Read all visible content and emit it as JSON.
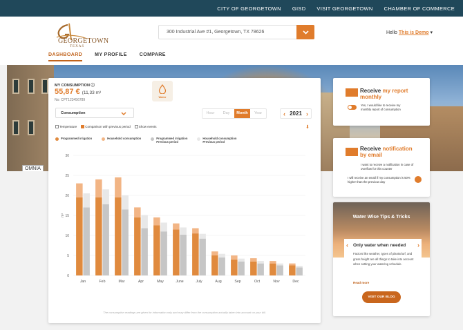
{
  "topbar": {
    "links": [
      "CITY OF GEORGETOWN",
      "GISD",
      "VISIT GEORGETOWN",
      "CHAMBER OF COMMERCE"
    ]
  },
  "brand": {
    "name": "GEORGETOWN",
    "sub": "TEXAS"
  },
  "address": {
    "value": "300 Industrial Ave #1, Georgetown, TX 78626"
  },
  "user": {
    "greeting": "Hello",
    "name": "This is Demo"
  },
  "nav": {
    "items": [
      "DASHBOARD",
      "MY PROFILE",
      "COMPARE"
    ],
    "active": "DASHBOARD"
  },
  "hero": {
    "sign": "OMNIA"
  },
  "consumption": {
    "title": "MY CONSUMPTION",
    "value": "55,87 €",
    "volume": "(11,33 m³",
    "number": "No: CPT123456789",
    "badge": "Water"
  },
  "controls": {
    "select": "Consumption",
    "periods": [
      "Hour",
      "Day",
      "Month",
      "Year"
    ],
    "active_period": "Month",
    "year": "2021",
    "checks": [
      {
        "label": "Temperature",
        "checked": false
      },
      {
        "label": "Comparison with previous period",
        "checked": true
      },
      {
        "label": "Show events",
        "checked": false
      }
    ]
  },
  "legend": [
    {
      "line1": "Programmed irrigation",
      "line2": "",
      "color": "#e08a3e"
    },
    {
      "line1": "Household consumption",
      "line2": "",
      "color": "#f2b585"
    },
    {
      "line1": "Programmed irrigation",
      "line2": "Previous period",
      "color": "#c6c6c6"
    },
    {
      "line1": "Household consumption",
      "line2": "Previous period",
      "color": "#e8e8e8"
    }
  ],
  "chart_data": {
    "type": "bar",
    "ylabel": "m³",
    "ylim": [
      0,
      30
    ],
    "yticks": [
      0,
      5,
      10,
      15,
      20,
      25,
      30
    ],
    "categories": [
      "Jan",
      "Feb",
      "Mar",
      "Apr",
      "May",
      "June",
      "July",
      "Aug",
      "Sep",
      "Oct",
      "Nov",
      "Dec"
    ],
    "series": [
      {
        "name": "Programmed irrigation",
        "values": [
          19.5,
          19.5,
          19.5,
          14.5,
          12.5,
          11.5,
          10.5,
          5,
          4,
          3.5,
          3,
          2.5
        ]
      },
      {
        "name": "Household consumption",
        "values": [
          3.5,
          4.5,
          5,
          2.5,
          2,
          1.5,
          1.3,
          1,
          1,
          0.8,
          0.6,
          0.5
        ]
      },
      {
        "name": "Programmed irrigation Previous period",
        "values": [
          17,
          17.8,
          16.5,
          11.8,
          11,
          10.2,
          9.2,
          4.5,
          3.5,
          3,
          2.5,
          2
        ]
      },
      {
        "name": "Household consumption Previous period",
        "values": [
          3.5,
          3.7,
          3.5,
          3.3,
          2.2,
          1.8,
          1.2,
          0.9,
          0.7,
          0.6,
          0.5,
          0.4
        ]
      }
    ],
    "colors": [
      "#e08a3e",
      "#f2b585",
      "#c6c6c6",
      "#e8e8e8"
    ]
  },
  "disclaimer": "The consumption readings are given for information only and may differ from the consumption actually taken into account on your bill.",
  "report": {
    "title_a": "Receive",
    "title_b": "my report",
    "title_c": "monthly",
    "text": "Yes, I would like to receive my monthly report of consumption"
  },
  "notify": {
    "title_a": "Receive",
    "title_b": "notification",
    "title_c": "by email",
    "text1": "I want to receive a notification in case of overflow for this counter",
    "text2": "I will receive an email if my consumption is 50% higher than the previous day"
  },
  "tips": {
    "title": "Water Wise Tips & Tricks",
    "heading": "Only water when needed",
    "text": "Factors like weather, types of plants/turf, and grass height are all things to take into account when setting your watering schedule.",
    "read_more": "Read more",
    "button": "VISIT OUR BLOG"
  }
}
